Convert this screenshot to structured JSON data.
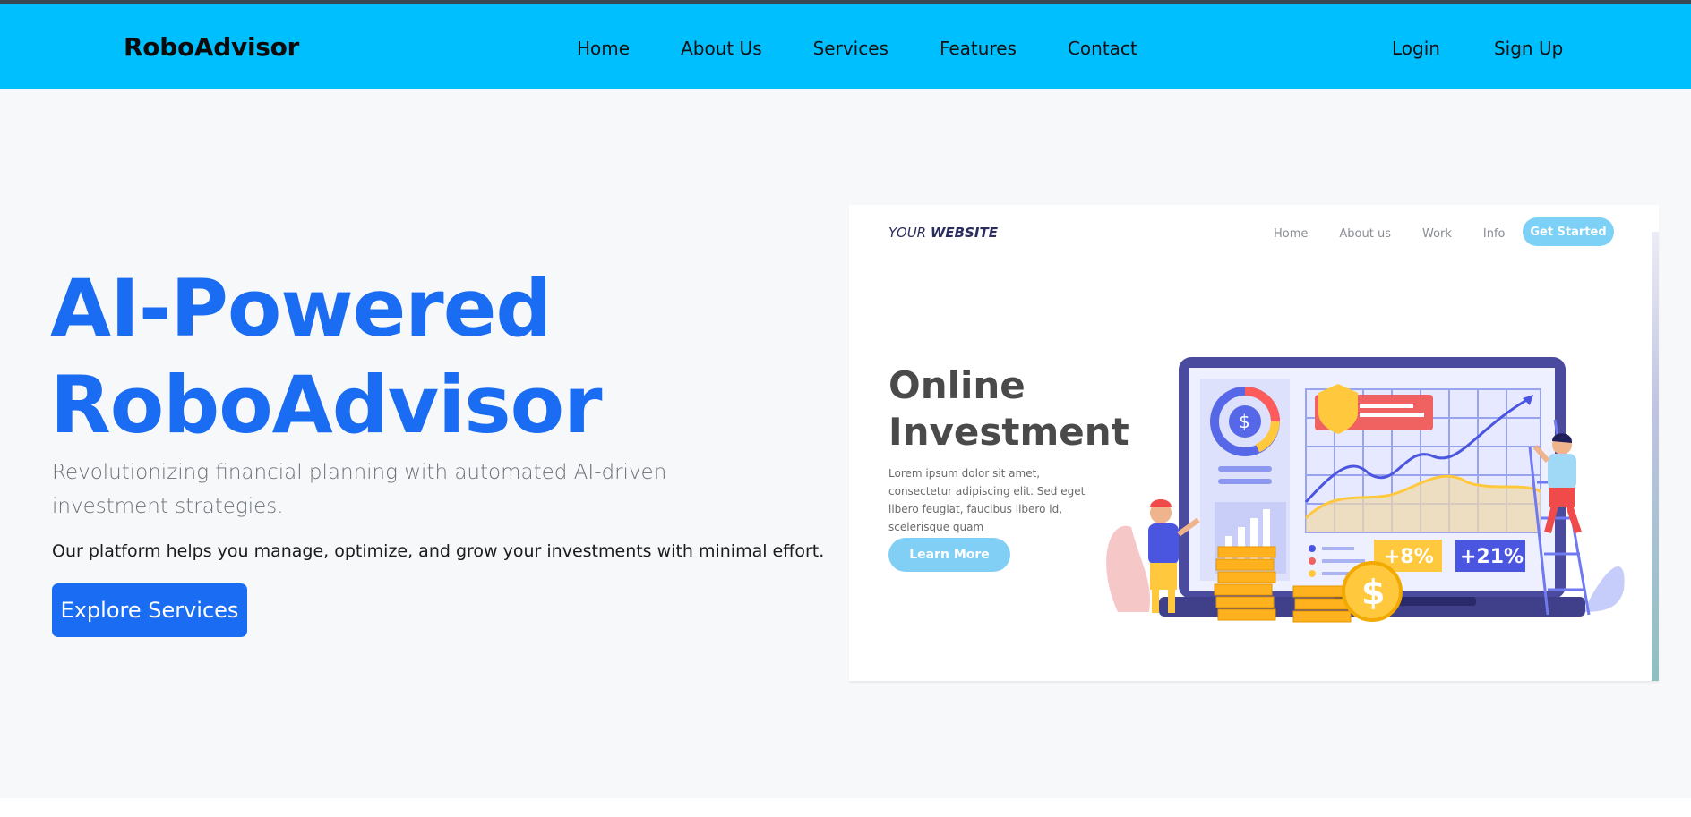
{
  "navbar": {
    "brand": "RoboAdvisor",
    "links": [
      "Home",
      "About Us",
      "Services",
      "Features",
      "Contact"
    ],
    "auth": [
      "Login",
      "Sign Up"
    ],
    "background": "#00bfff"
  },
  "hero": {
    "title_line1": "AI-Powered",
    "title_line2": "RoboAdvisor",
    "subtitle": "Revolutionizing financial planning with automated AI-driven investment strategies.",
    "description": "Our platform helps you manage, optimize, and grow your investments with minimal effort.",
    "cta_label": "Explore Services",
    "accent": "#1a6cf2"
  },
  "illustration": {
    "brand_prefix": "YOUR ",
    "brand_bold": "WEBSITE",
    "nav": [
      "Home",
      "About us",
      "Work",
      "Info"
    ],
    "nav_button": "Get Started",
    "heading_line1": "Online",
    "heading_line2": "Investment",
    "lorem": "Lorem ipsum dolor sit amet, consectetur adipiscing elit. Sed eget libero feugiat, faucibus libero id, scelerisque quam",
    "learn_more": "Learn More",
    "stat1": "+8%",
    "stat2": "+21%",
    "dollar": "$"
  }
}
